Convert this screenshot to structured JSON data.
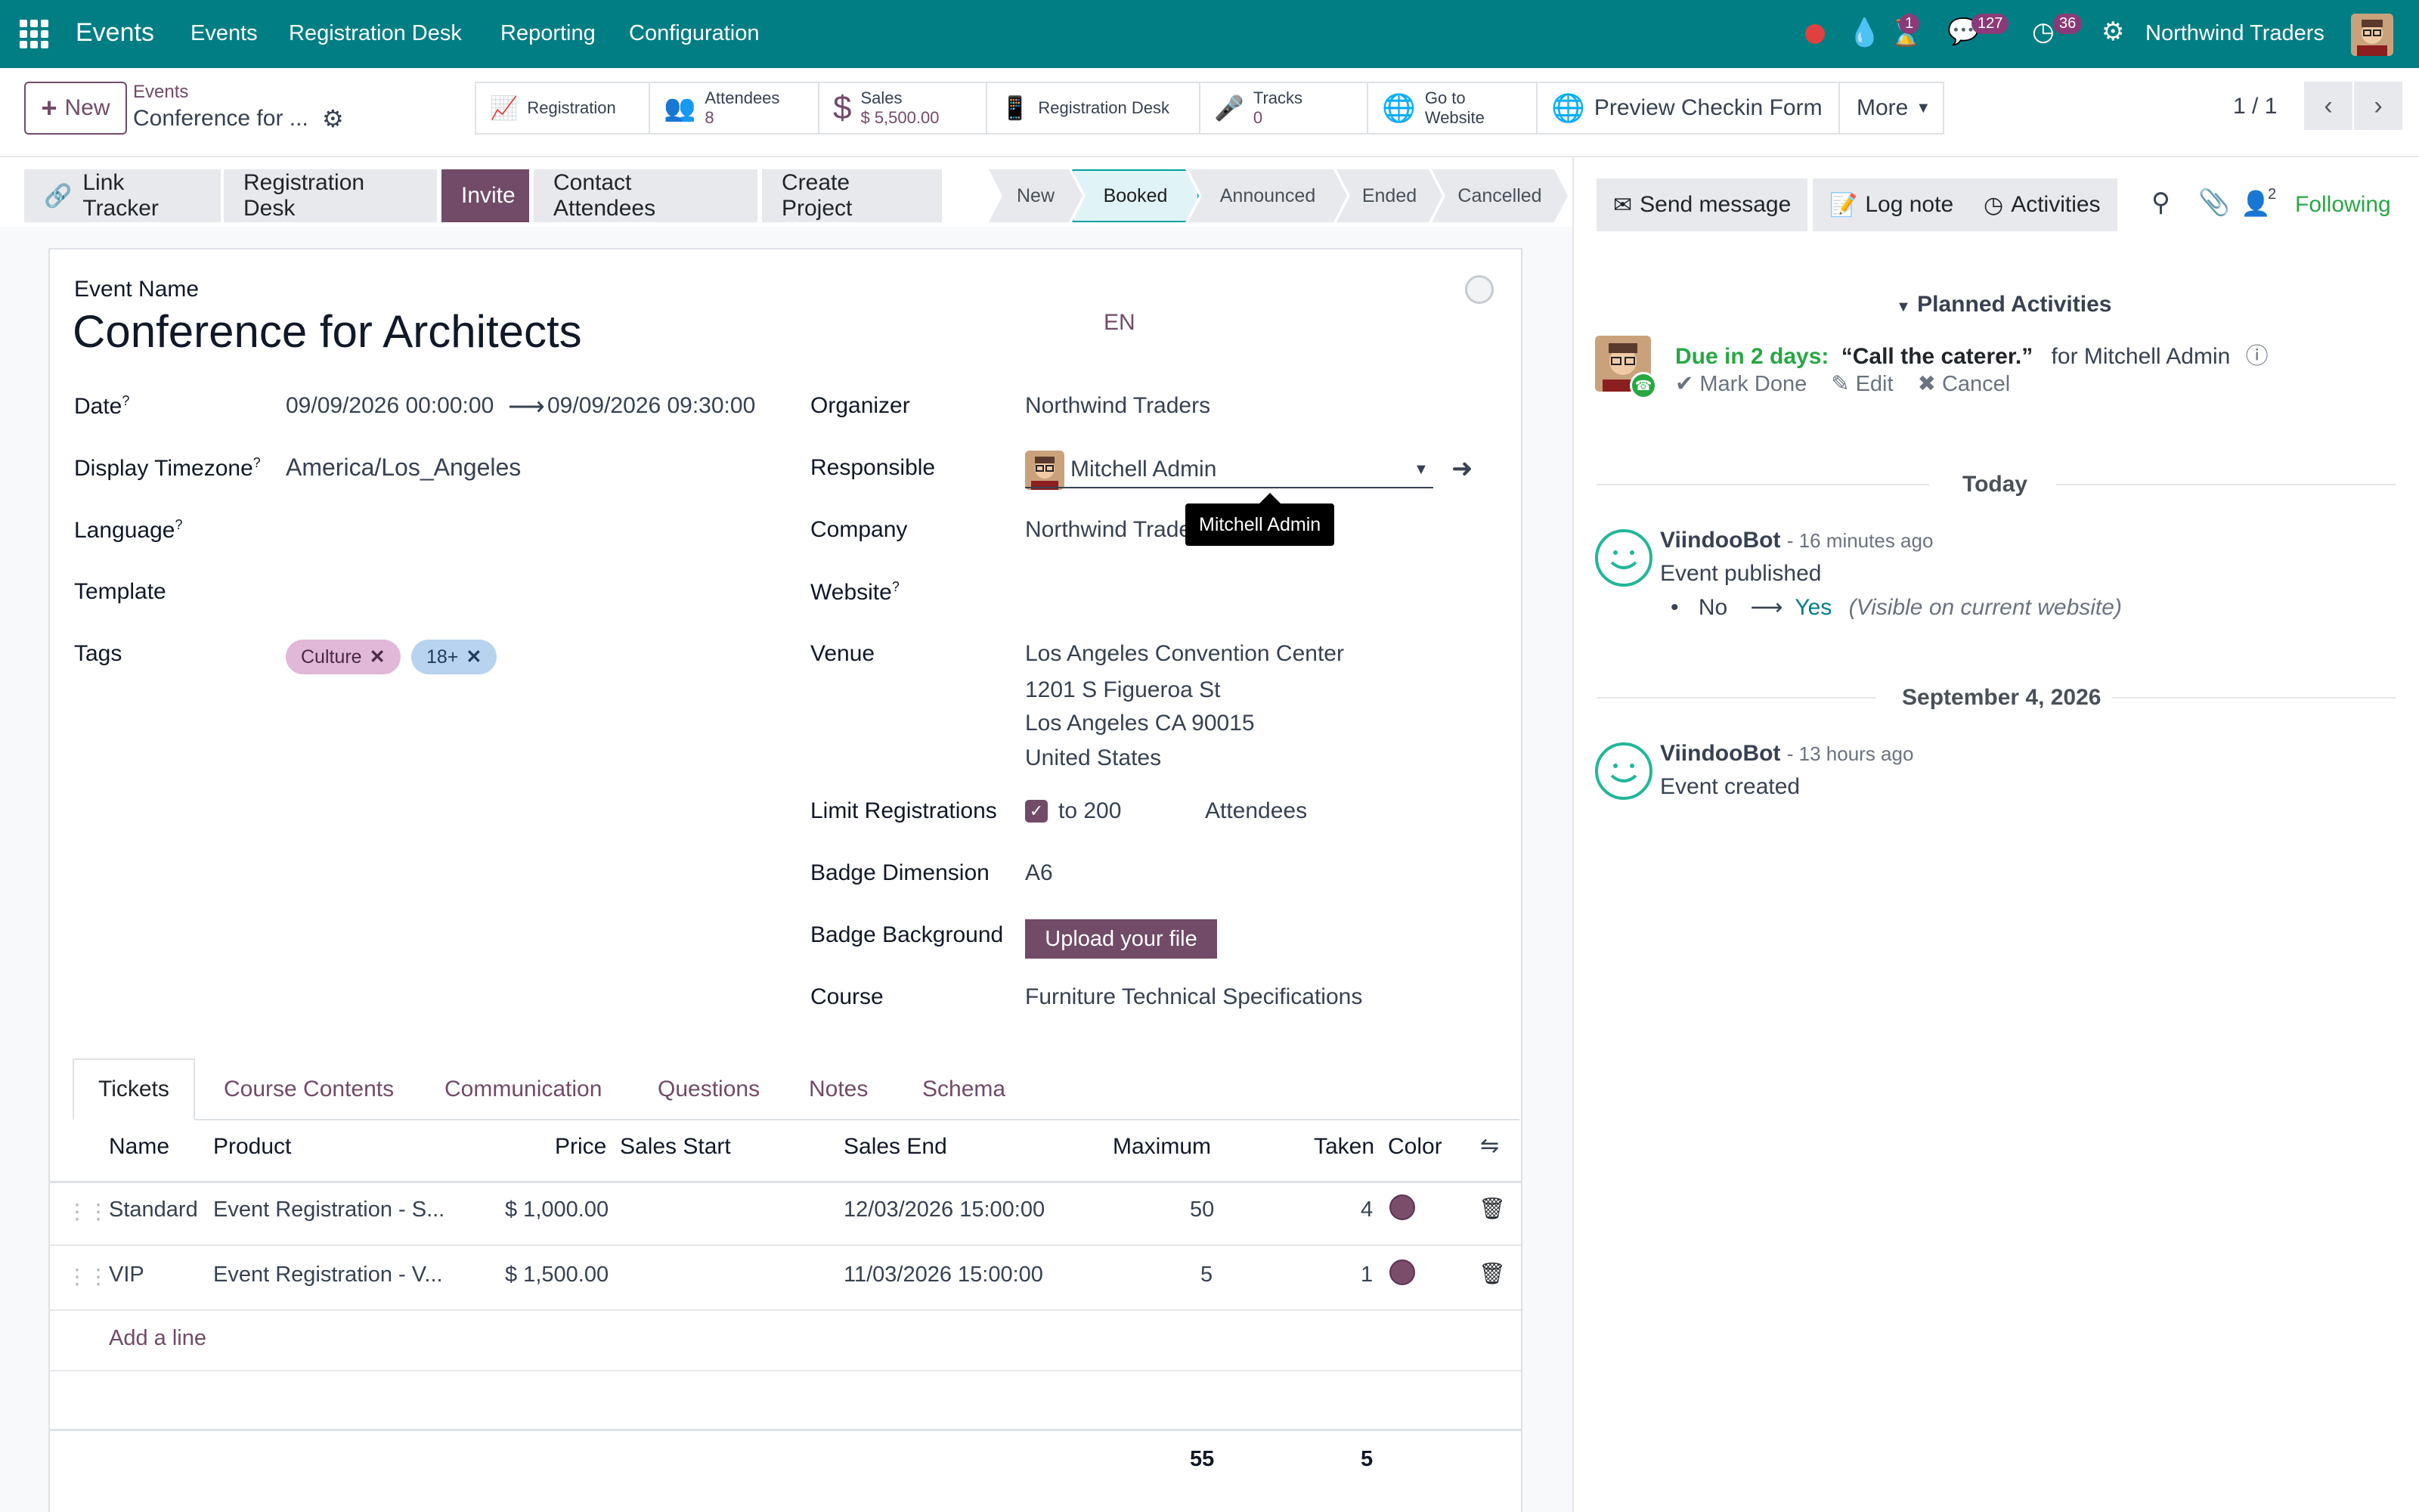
{
  "navbar": {
    "app_name": "Events",
    "menus": [
      "Events",
      "Registration Desk",
      "Reporting",
      "Configuration"
    ],
    "activity_badge": "1",
    "messages_badge": "127",
    "clock_badge": "36",
    "company": "Northwind Traders"
  },
  "control": {
    "new_label": "New",
    "breadcrumb_parent": "Events",
    "breadcrumb_current": "Conference for ...",
    "pager": "1 / 1",
    "smart_buttons": {
      "registration": "Registration",
      "attendees_label": "Attendees",
      "attendees_value": "8",
      "sales_label": "Sales",
      "sales_value": "$ 5,500.00",
      "registration_desk": "Registration Desk",
      "tracks_label": "Tracks",
      "tracks_value": "0",
      "website_line1": "Go to",
      "website_line2": "Website",
      "preview": "Preview Checkin Form",
      "more": "More"
    }
  },
  "actions": [
    "Link Tracker",
    "Registration Desk",
    "Invite",
    "Contact Attendees",
    "Create Project"
  ],
  "stages": [
    "New",
    "Booked",
    "Announced",
    "Ended",
    "Cancelled"
  ],
  "active_stage": "Booked",
  "form": {
    "event_name_label": "Event Name",
    "event_name": "Conference for Architects",
    "lang_code": "EN",
    "date_label": "Date",
    "date_start": "09/09/2026 00:00:00",
    "date_end": "09/09/2026 09:30:00",
    "timezone_label": "Display Timezone",
    "timezone": "America/Los_Angeles",
    "language_label": "Language",
    "template_label": "Template",
    "tags_label": "Tags",
    "tags": [
      "Culture",
      "18+"
    ],
    "organizer_label": "Organizer",
    "organizer": "Northwind Traders",
    "responsible_label": "Responsible",
    "responsible": "Mitchell Admin",
    "tooltip": "Mitchell Admin",
    "company_label": "Company",
    "company": "Northwind Trade",
    "website_label": "Website",
    "venue_label": "Venue",
    "venue_lines": [
      "Los Angeles Convention Center",
      "1201 S Figueroa St",
      "Los Angeles CA 90015",
      "United States"
    ],
    "limit_label": "Limit Registrations",
    "limit_to": "to 200",
    "limit_unit": "Attendees",
    "badge_dim_label": "Badge Dimension",
    "badge_dim": "A6",
    "badge_bg_label": "Badge Background",
    "upload_label": "Upload your file",
    "course_label": "Course",
    "course": "Furniture Technical Specifications",
    "question_mark": "?"
  },
  "tabs": [
    "Tickets",
    "Course Contents",
    "Communication",
    "Questions",
    "Notes",
    "Schema"
  ],
  "tickets": {
    "headers": [
      "Name",
      "Product",
      "Price",
      "Sales Start",
      "Sales End",
      "Maximum",
      "Taken",
      "Color"
    ],
    "rows": [
      {
        "name": "Standard",
        "product": "Event Registration - S...",
        "price": "$ 1,000.00",
        "sales_start": "",
        "sales_end": "12/03/2026 15:00:00",
        "maximum": "50",
        "taken": "4"
      },
      {
        "name": "VIP",
        "product": "Event Registration - V...",
        "price": "$ 1,500.00",
        "sales_start": "",
        "sales_end": "11/03/2026 15:00:00",
        "maximum": "5",
        "taken": "1"
      }
    ],
    "add_line": "Add a line",
    "total_maximum": "55",
    "total_taken": "5"
  },
  "chatter": {
    "send_message": "Send message",
    "log_note": "Log note",
    "activities": "Activities",
    "followers_count": "2",
    "following": "Following",
    "planned_header": "Planned Activities",
    "activity_due": "Due in 2 days:",
    "activity_title": "“Call the caterer.”",
    "activity_for": "for Mitchell Admin",
    "mark_done": "Mark Done",
    "edit": "Edit",
    "cancel": "Cancel",
    "today": "Today",
    "msg1_author": "ViindooBot",
    "msg1_time": "- 16 minutes ago",
    "msg1_text": "Event published",
    "msg1_old": "No",
    "msg1_new": "Yes",
    "msg1_field": "(Visible on current website)",
    "date_sep": "September 4, 2026",
    "msg2_author": "ViindooBot",
    "msg2_time": "- 13 hours ago",
    "msg2_text": "Event created"
  },
  "colors": {
    "brand": "#017e84",
    "accent": "#714b67",
    "ticket_color": "#7a4d6a"
  }
}
